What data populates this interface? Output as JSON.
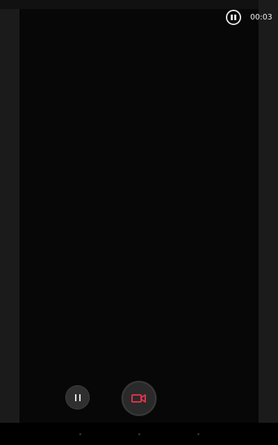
{
  "status": {
    "pause_icon": "pause-circle-icon",
    "timer": "00:03"
  },
  "controls": {
    "pause_icon": "pause-icon",
    "record_icon": "video-camera-icon",
    "record_color": "#e0334a"
  },
  "nav": {
    "items": [
      "back",
      "home",
      "recents"
    ]
  }
}
